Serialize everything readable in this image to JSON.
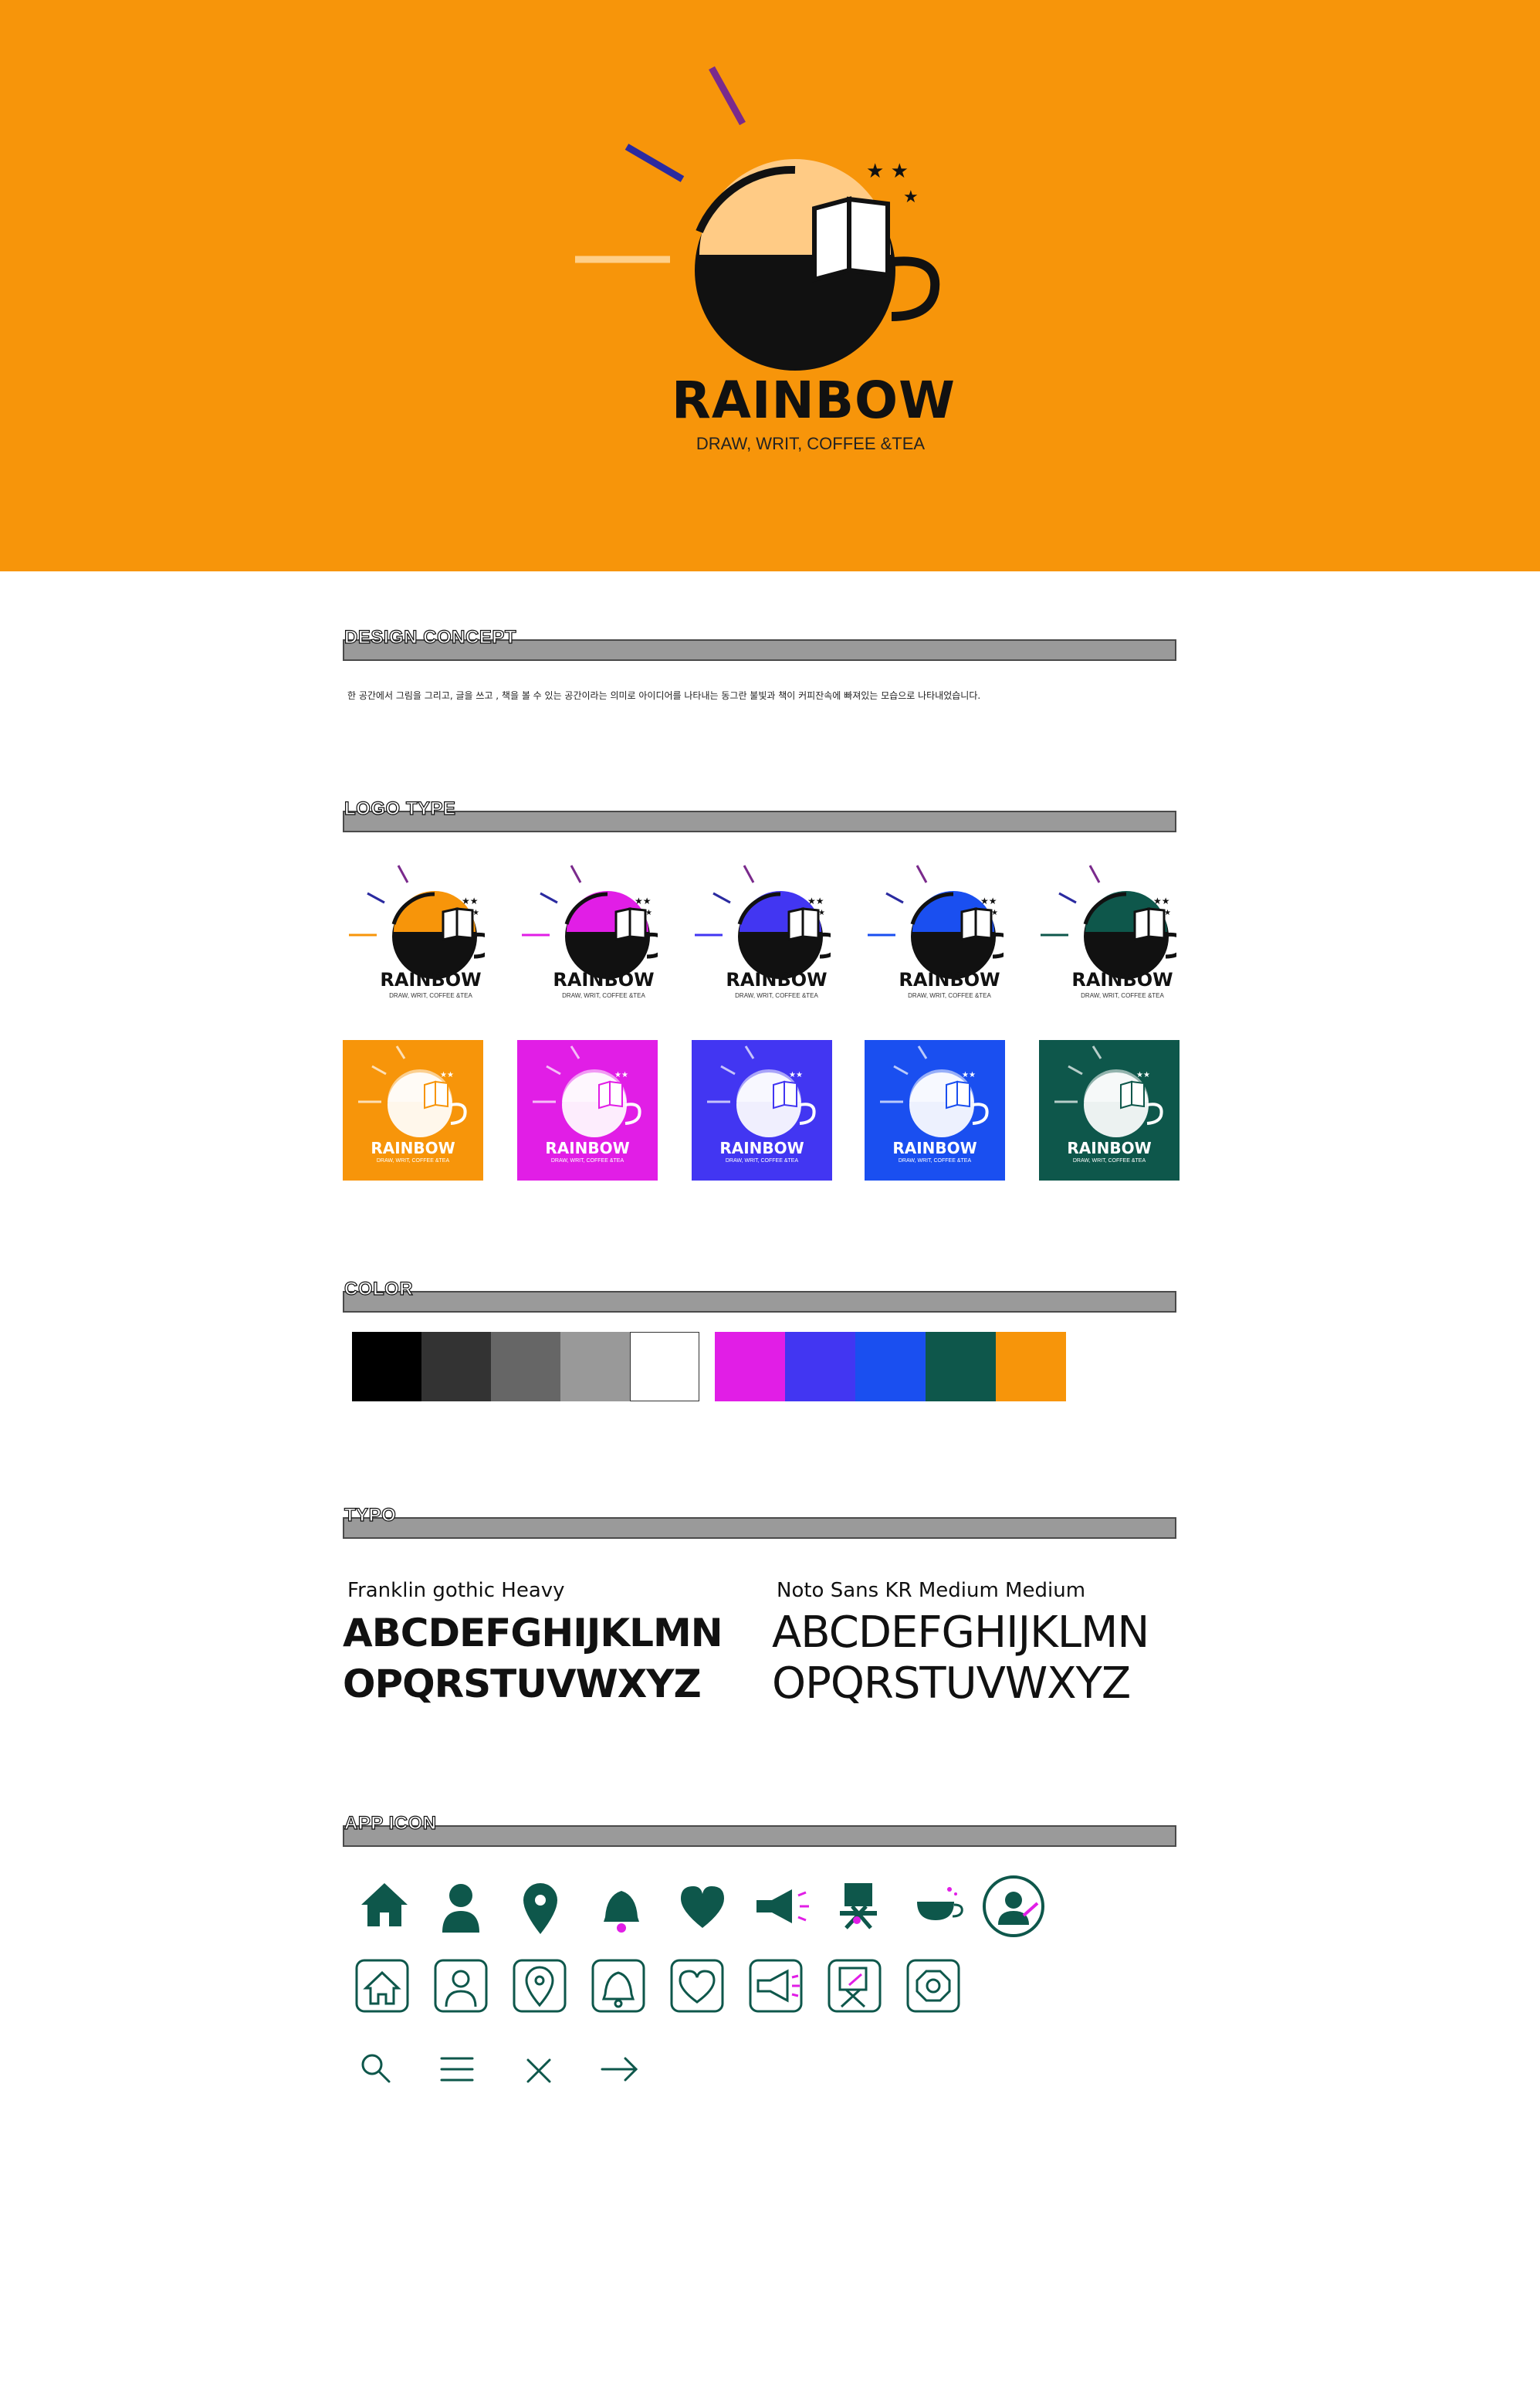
{
  "brand": {
    "name": "RAINBOW",
    "tagline": "DRAW, WRIT, COFFEE &TEA"
  },
  "sections": {
    "concept": "DESIGN CONCEPT",
    "logotype": "LOGO TYPE",
    "color": "COLOR",
    "typo": "TYPO",
    "appicon": "APP ICON"
  },
  "concept_text": "한 공간에서 그림을 그리고, 글을 쓰고 , 책을 볼 수 있는 공간이라는 의미로 아이디어를 나타내는 동그란 불빛과 책이 커피잔속에 빠져있는 모습으로 나타내었습니다.",
  "logo_variants": [
    {
      "accent": "#f7950a"
    },
    {
      "accent": "#e11ee6"
    },
    {
      "accent": "#4236f2"
    },
    {
      "accent": "#1a4ff0"
    },
    {
      "accent": "#0e574b"
    }
  ],
  "colors": {
    "grays": [
      "#000000",
      "#333333",
      "#666666",
      "#999999",
      "#ffffff"
    ],
    "brand": [
      "#e11ee6",
      "#4236f2",
      "#1a4ff0",
      "#0e574b",
      "#f7950a"
    ]
  },
  "typography": {
    "font1_name": "Franklin gothic Heavy",
    "font2_name": "Noto Sans KR Medium Medium",
    "line1": "ABCDEFGHIJKLMN",
    "line2": "OPQRSTUVWXYZ"
  },
  "app_icons": {
    "filled": [
      "home-icon",
      "user-icon",
      "location-pin-icon",
      "bell-icon",
      "heart-icon",
      "megaphone-icon",
      "easel-icon",
      "coffee-cup-icon",
      "profile-badge-icon"
    ],
    "outlined": [
      "home-outline-icon",
      "user-outline-icon",
      "location-outline-icon",
      "bell-outline-icon",
      "heart-outline-icon",
      "megaphone-outline-icon",
      "easel-outline-icon",
      "settings-outline-icon"
    ],
    "line": [
      "search-icon",
      "menu-icon",
      "close-icon",
      "arrow-right-icon"
    ],
    "icon_color": "#0e574b",
    "highlight_color": "#e11ee6"
  }
}
